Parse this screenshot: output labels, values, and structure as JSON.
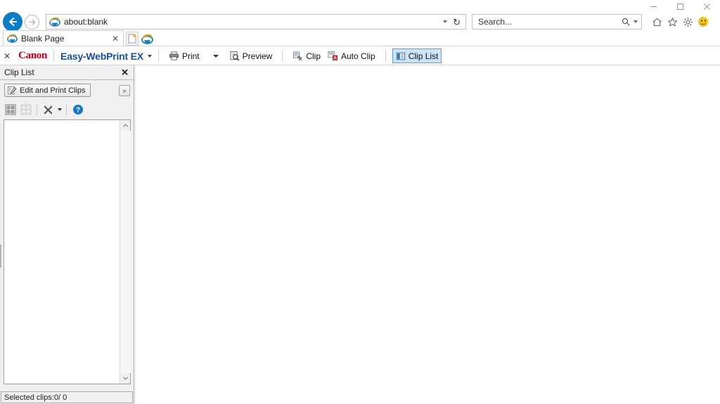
{
  "window": {
    "controls": [
      {
        "name": "minimize",
        "label": "—"
      },
      {
        "name": "maximize",
        "label": "□"
      },
      {
        "name": "close",
        "label": "✕"
      }
    ]
  },
  "navigation": {
    "back_label": "←",
    "forward_label": "→",
    "address_value": "about:blank",
    "address_dropdown_icon": "chevron-down-icon",
    "refresh_icon": "↻",
    "search_placeholder": "Search...",
    "search_icon": "search-icon",
    "icons": [
      {
        "name": "home-icon",
        "title": "Home"
      },
      {
        "name": "favorites-star-icon",
        "title": "Favorites"
      },
      {
        "name": "tools-gear-icon",
        "title": "Tools"
      },
      {
        "name": "smiley-feedback-icon",
        "title": "Send a Smile"
      }
    ]
  },
  "tabs": {
    "items": [
      {
        "label": "Blank Page",
        "close_label": "✕",
        "icon": "ie-icon"
      }
    ],
    "new_tab_label": "",
    "new_tab_icon": "new-tab-icon",
    "ie_tab_icon": "ie-icon"
  },
  "canon_toolbar": {
    "close_label": "✕",
    "brand": "Canon",
    "product": "Easy-WebPrint EX",
    "product_caret": "▾",
    "items": [
      {
        "id": "print",
        "label": "Print",
        "icon": "printer-icon",
        "has_dropdown": true,
        "active": false
      },
      {
        "id": "preview",
        "label": "Preview",
        "icon": "preview-magnifier-icon",
        "has_dropdown": false,
        "active": false
      },
      {
        "id": "clip",
        "label": "Clip",
        "icon": "clip-icon",
        "has_dropdown": false,
        "active": false
      },
      {
        "id": "auto-clip",
        "label": "Auto Clip",
        "icon": "auto-clip-icon",
        "has_dropdown": false,
        "active": false
      },
      {
        "id": "clip-list",
        "label": "Clip List",
        "icon": "clip-list-icon",
        "has_dropdown": false,
        "active": true
      }
    ]
  },
  "clip_panel": {
    "title": "Clip List",
    "close_label": "✕",
    "edit_button_label": "Edit and Print Clips",
    "expand_button_label": "»",
    "tools": [
      {
        "name": "select-all-clips-icon",
        "label": ""
      },
      {
        "name": "deselect-all-clips-icon",
        "label": ""
      },
      {
        "name": "delete-clips-icon",
        "label": "✕",
        "has_dropdown": true
      },
      {
        "name": "help-icon",
        "label": "?"
      }
    ],
    "scroll_up_label": "ⱏ",
    "scroll_down_label": "ⱞ",
    "status_text": "Selected clips:0/ 0",
    "clips": []
  },
  "colors": {
    "accent_blue": "#0c7cc4",
    "canon_red": "#cc0018",
    "product_blue": "#1d4e9b",
    "active_tab_bg": "#cce4f7",
    "active_tab_border": "#5a9fd8",
    "panel_bg": "#f0f0f0",
    "content_bg": "#ffffff",
    "smiley_yellow": "#f5c518"
  }
}
